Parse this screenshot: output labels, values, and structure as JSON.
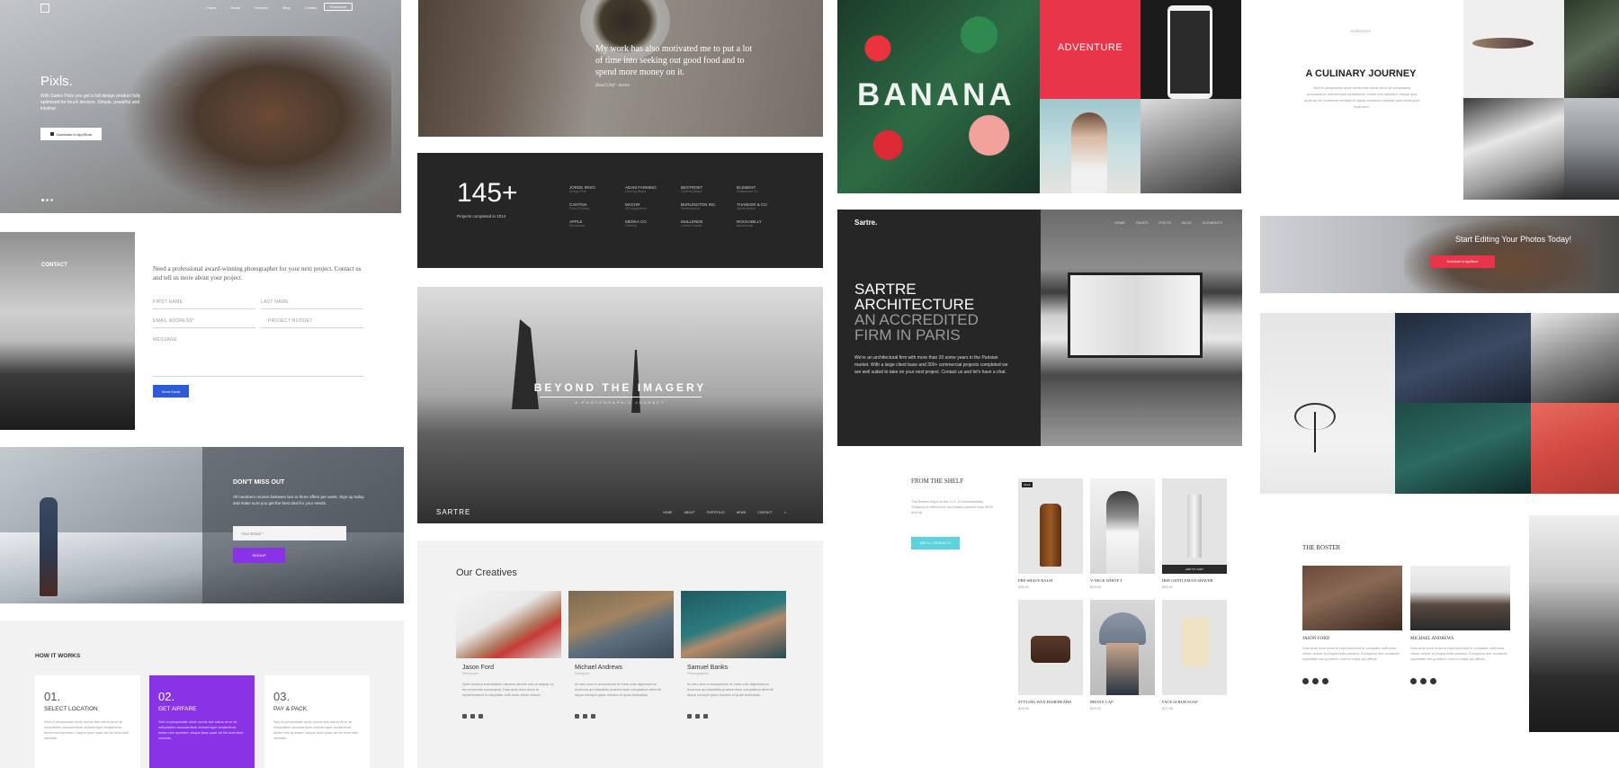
{
  "hero": {
    "brand": "Pixls.",
    "text": "With Sartre Pixls you get a full design product fully optimized for touch devices. Simple, powerful and intuitive.",
    "button": "Download in AppStore",
    "nav": [
      "Home",
      "About",
      "Services",
      "Blog",
      "Contact"
    ],
    "nav_button": "Download"
  },
  "quote": {
    "text": "My work has also motivated me to put a lot of time into seeking out good food and to spend more money on it.",
    "author": "Head Chef - Sartre"
  },
  "stats": {
    "number": "145+",
    "caption": "Projects completed in 2014",
    "clients": [
      [
        "JORDE IRISO",
        "Design Firm"
      ],
      [
        "ADAM FARMING",
        "Clothing Brand"
      ],
      [
        "BESTROET",
        "Clothing Brand"
      ],
      [
        "ELEMENT",
        "Skateboard Co"
      ],
      [
        "CANTINA",
        "Food & Drinks"
      ],
      [
        "MACHR",
        "iOS Application"
      ],
      [
        "BURLINGTON INC.",
        "Development"
      ],
      [
        "THANKER & CO",
        "Sports Brand"
      ],
      [
        "APPLE",
        "Electronics"
      ],
      [
        "MEDKA CO",
        "Clothing"
      ],
      [
        "MULLENDE",
        "Leather Goods"
      ],
      [
        "ROCKABILLY",
        "Barbershop"
      ]
    ]
  },
  "banana": {
    "title": "BANANA",
    "adventure": "ADVENTURE"
  },
  "culinary": {
    "kicker": "SANGERS",
    "title": "A CULINARY JOURNEY",
    "text": "Sed ut perspiciatis unde omnis iste natus error sit voluptatem accusantium doloremque laudantium, totam rem aperiam, eaque ipsa quae ab illo inventore veritatis et quasi architecto beatae vitae dicta sunt explicabo."
  },
  "contact": {
    "title": "CONTACT",
    "intro": "Need a professional award-winning photographer for your next project. Contact us and tell us more about your project.",
    "first_name": "First Name",
    "last_name": "Last Name",
    "email": "Email address*",
    "subject": "Project Budget",
    "message": "Message",
    "send": "Send Email"
  },
  "beyond": {
    "title": "BEYOND THE IMAGERY",
    "subtitle": "A PHOTOGRAPHIC JOURNEY",
    "brand": "SARTRE",
    "nav": [
      "HOME",
      "ABOUT",
      "PORTFOLIO",
      "NEWS",
      "CONTACT"
    ]
  },
  "sartre": {
    "brand": "Sartre.",
    "nav": [
      "HOME",
      "PAGES",
      "POSTS",
      "BLOG",
      "ELEMENTS"
    ],
    "line1": "SARTRE",
    "line2": "ARCHITECTURE",
    "line3": "AN ACCREDITED",
    "line4": "FIRM IN PARIS",
    "text": "We're an architectural firm with more than 20 some years in the Parisian market. With a large client base and 300+ commercial projects completed we are well suited to take on your next project. Contact us and let's have a chat."
  },
  "editing": {
    "title": "Start Editing Your Photos Today!",
    "button": "Download in AppStore"
  },
  "dontmiss": {
    "title": "DON'T MISS OUT",
    "text": "All members receive between two to three offers per week. Sign up today and make sure you get the best deal for your needs.",
    "placeholder": "Your Email *",
    "button": "SIGNUP"
  },
  "creatives": {
    "title": "Our Creatives",
    "people": [
      {
        "name": "Jason Ford",
        "role": "Developer",
        "text": "Quis nostrud exercitation ullamco laboris nisi ut aliquip ex ea commodo consequat. Duis aute irure dolor in reprehenderit in voluptate velit esse cillum dolore."
      },
      {
        "name": "Michael Andrews",
        "role": "Designer",
        "text": "At vero eos et accusamus et iusto odio dignissimos ducimus qui blanditiis praesentium voluptatum deleniti atque corrupti quos dolores et quas molestias."
      },
      {
        "name": "Samuel Banks",
        "role": "Photographer",
        "text": "At vero eos et accusamus et iusto odio dignissimos ducimus qui blanditiis praesentium voluptatum deleniti atque corrupti quos dolores et quas molestias."
      }
    ]
  },
  "shelf": {
    "title": "FROM THE SHELF",
    "text": "The Barber ships to the U.S. & internationally. Shipping is offered for purchases greater than $200 and up.",
    "button": "SEE ALL PRODUCTS",
    "sale": "SALE",
    "add": "ADD TO CART",
    "products": [
      {
        "name": "PRE-SHAVE BALM",
        "price": "$35.00"
      },
      {
        "name": "V-NECK WHITE T",
        "price": "$29.00"
      },
      {
        "name": "HER GENTLEMAN SHAVER",
        "price": "$55.00"
      },
      {
        "name": "STYLING WAX HAIR/BEARD",
        "price": "$18.00"
      },
      {
        "name": "BRONX CAP",
        "price": "$25.00"
      },
      {
        "name": "FACE SCRUB SOAP",
        "price": "$17.00"
      }
    ]
  },
  "howitworks": {
    "title": "HOW IT WORKS",
    "steps": [
      {
        "num": "01.",
        "title": "SELECT LOCATION",
        "text": "Sed ut perspiciatis unde omnis iste natus error sit voluptatem accusantium doloremque laudantium, totam rem aperiam, eaque ipsa quae ab illo inventore veritatis."
      },
      {
        "num": "02.",
        "title": "GET AIRFARE",
        "text": "Sed ut perspiciatis unde omnis iste natus error sit voluptatem accusantium doloremque laudantium, totam rem aperiam, eaque ipsa quae ab illo inventore veritatis."
      },
      {
        "num": "03.",
        "title": "PAY & PACK",
        "text": "Sed ut perspiciatis unde omnis iste natus error sit voluptatem accusantium doloremque laudantium, totam rem aperiam, eaque ipsa quae ab illo inventore veritatis."
      }
    ]
  },
  "roster": {
    "title": "THE ROSTER",
    "people": [
      {
        "name": "JASON FORD",
        "text": "Duis aute irure dolor in reprehenderit in voluptate velit esse cillum dolore eu fugiat nulla pariatur. Excepteur sint occaecat cupidatat non proident, sunt in culpa qui officia."
      },
      {
        "name": "MICHAEL ANDREWS",
        "text": "Duis aute irure dolor in reprehenderit in voluptate velit esse cillum dolore eu fugiat nulla pariatur. Excepteur sint occaecat cupidatat non proident, sunt in culpa qui officia."
      }
    ]
  },
  "colors": {
    "purple": "#8a33e6",
    "blue": "#2d5bd8",
    "red": "#e8354a",
    "teal": "#5bd3dd",
    "dark": "#262626"
  }
}
